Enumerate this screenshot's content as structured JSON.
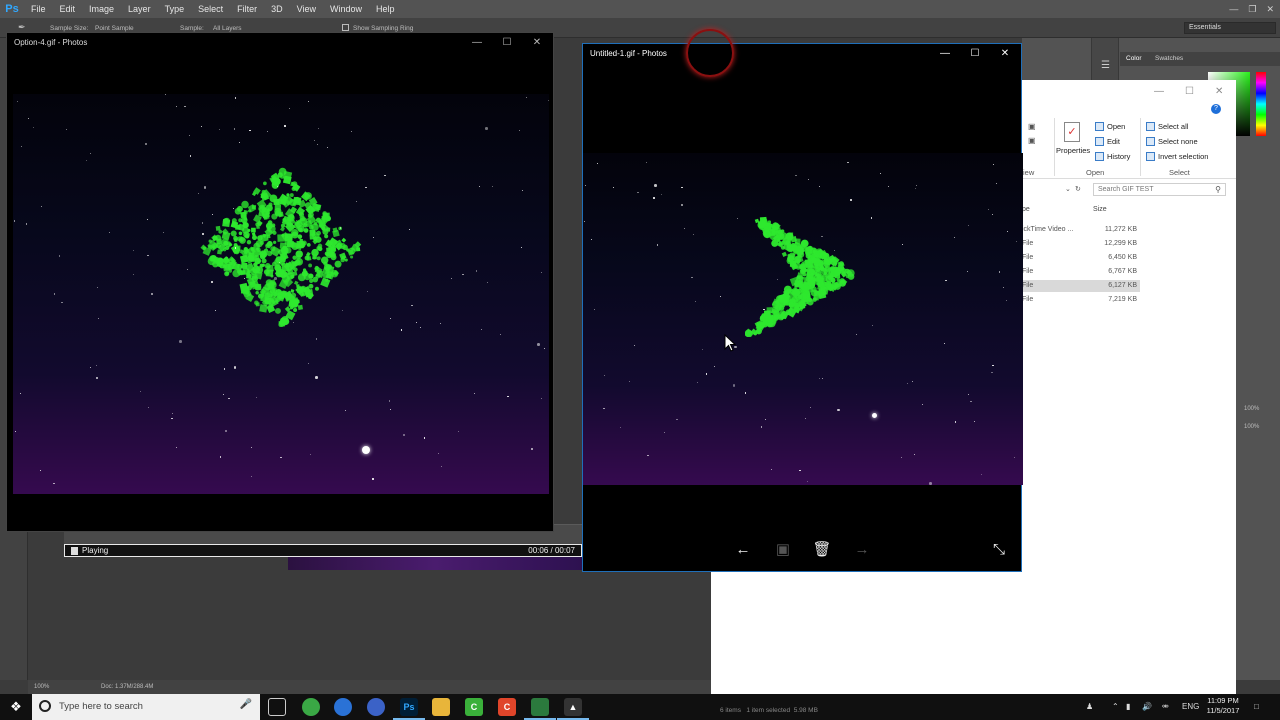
{
  "photoshop": {
    "logo": "Ps",
    "menu": [
      "File",
      "Edit",
      "Image",
      "Layer",
      "Type",
      "Select",
      "Filter",
      "3D",
      "View",
      "Window",
      "Help"
    ],
    "options": {
      "sample_size_label": "Sample Size:",
      "sample_size_value": "Point Sample",
      "sample_label": "Sample:",
      "sample_value": "All Layers",
      "show_sampling_ring": "Show Sampling Ring"
    },
    "workspace": "Essentials",
    "panel_tabs": [
      "Color",
      "Swatches"
    ],
    "zoom": "100%",
    "doc_size": "Doc: 1.37M/288.4M",
    "opacity_value": "100%",
    "fill_value": "100%"
  },
  "timeline": {
    "status": "Playing",
    "time": "00:06 / 00:07"
  },
  "photos_left": {
    "title": "Option-4.gif - Photos"
  },
  "photos_right": {
    "title": "Untitled-1.gif - Photos"
  },
  "explorer": {
    "ribbon": {
      "open": "Open",
      "edit": "Edit",
      "history": "History",
      "properties": "Properties",
      "select_all": "Select all",
      "select_none": "Select none",
      "invert_selection": "Invert selection",
      "group_open": "Open",
      "group_select": "Select",
      "group_view": "iew"
    },
    "search_placeholder": "Search GIF TEST",
    "columns": {
      "type": "pe",
      "size": "Size"
    },
    "files": [
      {
        "type": "ickTime Video ...",
        "size": "11,272 KB"
      },
      {
        "type": "File",
        "size": "12,299 KB"
      },
      {
        "type": "File",
        "size": "6,450 KB"
      },
      {
        "type": "File",
        "size": "6,767 KB"
      },
      {
        "type": "File",
        "size": "6,127 KB",
        "selected": true
      },
      {
        "type": "File",
        "size": "7,219 KB"
      }
    ],
    "status_bar": "6 items   1 item selected  5.98 MB"
  },
  "taskbar": {
    "search_placeholder": "Type here to search",
    "language": "ENG",
    "time": "11:09 PM",
    "date": "11/5/2017"
  },
  "colors": {
    "green_particles": "#2ee82e",
    "ps_blue": "#31a8ff"
  }
}
